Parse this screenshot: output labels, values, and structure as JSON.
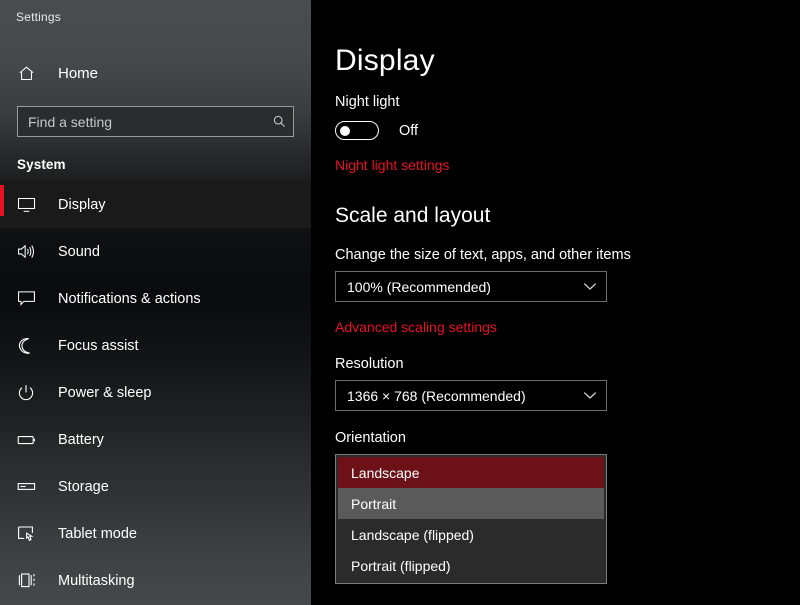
{
  "window": {
    "title": "Settings"
  },
  "accent": {
    "red": "#e81123",
    "selected_item_bg": "#6b1117",
    "hover_item_bg": "#5a5a5a"
  },
  "sidebar": {
    "home": {
      "label": "Home",
      "icon": "home-icon"
    },
    "search": {
      "value": "",
      "placeholder": "Find a setting",
      "icon": "search-icon"
    },
    "group_label": "System",
    "items": [
      {
        "label": "Display",
        "icon": "monitor-icon",
        "active": true
      },
      {
        "label": "Sound",
        "icon": "speaker-icon",
        "active": false
      },
      {
        "label": "Notifications & actions",
        "icon": "notification-icon",
        "active": false
      },
      {
        "label": "Focus assist",
        "icon": "moon-icon",
        "active": false
      },
      {
        "label": "Power & sleep",
        "icon": "power-icon",
        "active": false
      },
      {
        "label": "Battery",
        "icon": "battery-icon",
        "active": false
      },
      {
        "label": "Storage",
        "icon": "storage-icon",
        "active": false
      },
      {
        "label": "Tablet mode",
        "icon": "tablet-mode-icon",
        "active": false
      },
      {
        "label": "Multitasking",
        "icon": "multitasking-icon",
        "active": false
      }
    ]
  },
  "main": {
    "page_title": "Display",
    "night_light": {
      "label": "Night light",
      "toggle_state": "Off",
      "settings_link": "Night light settings"
    },
    "scale_and_layout": {
      "section_title": "Scale and layout",
      "scale_label": "Change the size of text, apps, and other items",
      "scale_value": "100% (Recommended)",
      "advanced_link": "Advanced scaling settings"
    },
    "resolution": {
      "label": "Resolution",
      "value": "1366 × 768 (Recommended)"
    },
    "orientation": {
      "label": "Orientation",
      "value": "Landscape",
      "options": [
        {
          "label": "Landscape",
          "state": "selected"
        },
        {
          "label": "Portrait",
          "state": "hover"
        },
        {
          "label": "Landscape (flipped)",
          "state": "normal"
        },
        {
          "label": "Portrait (flipped)",
          "state": "normal"
        }
      ]
    }
  }
}
